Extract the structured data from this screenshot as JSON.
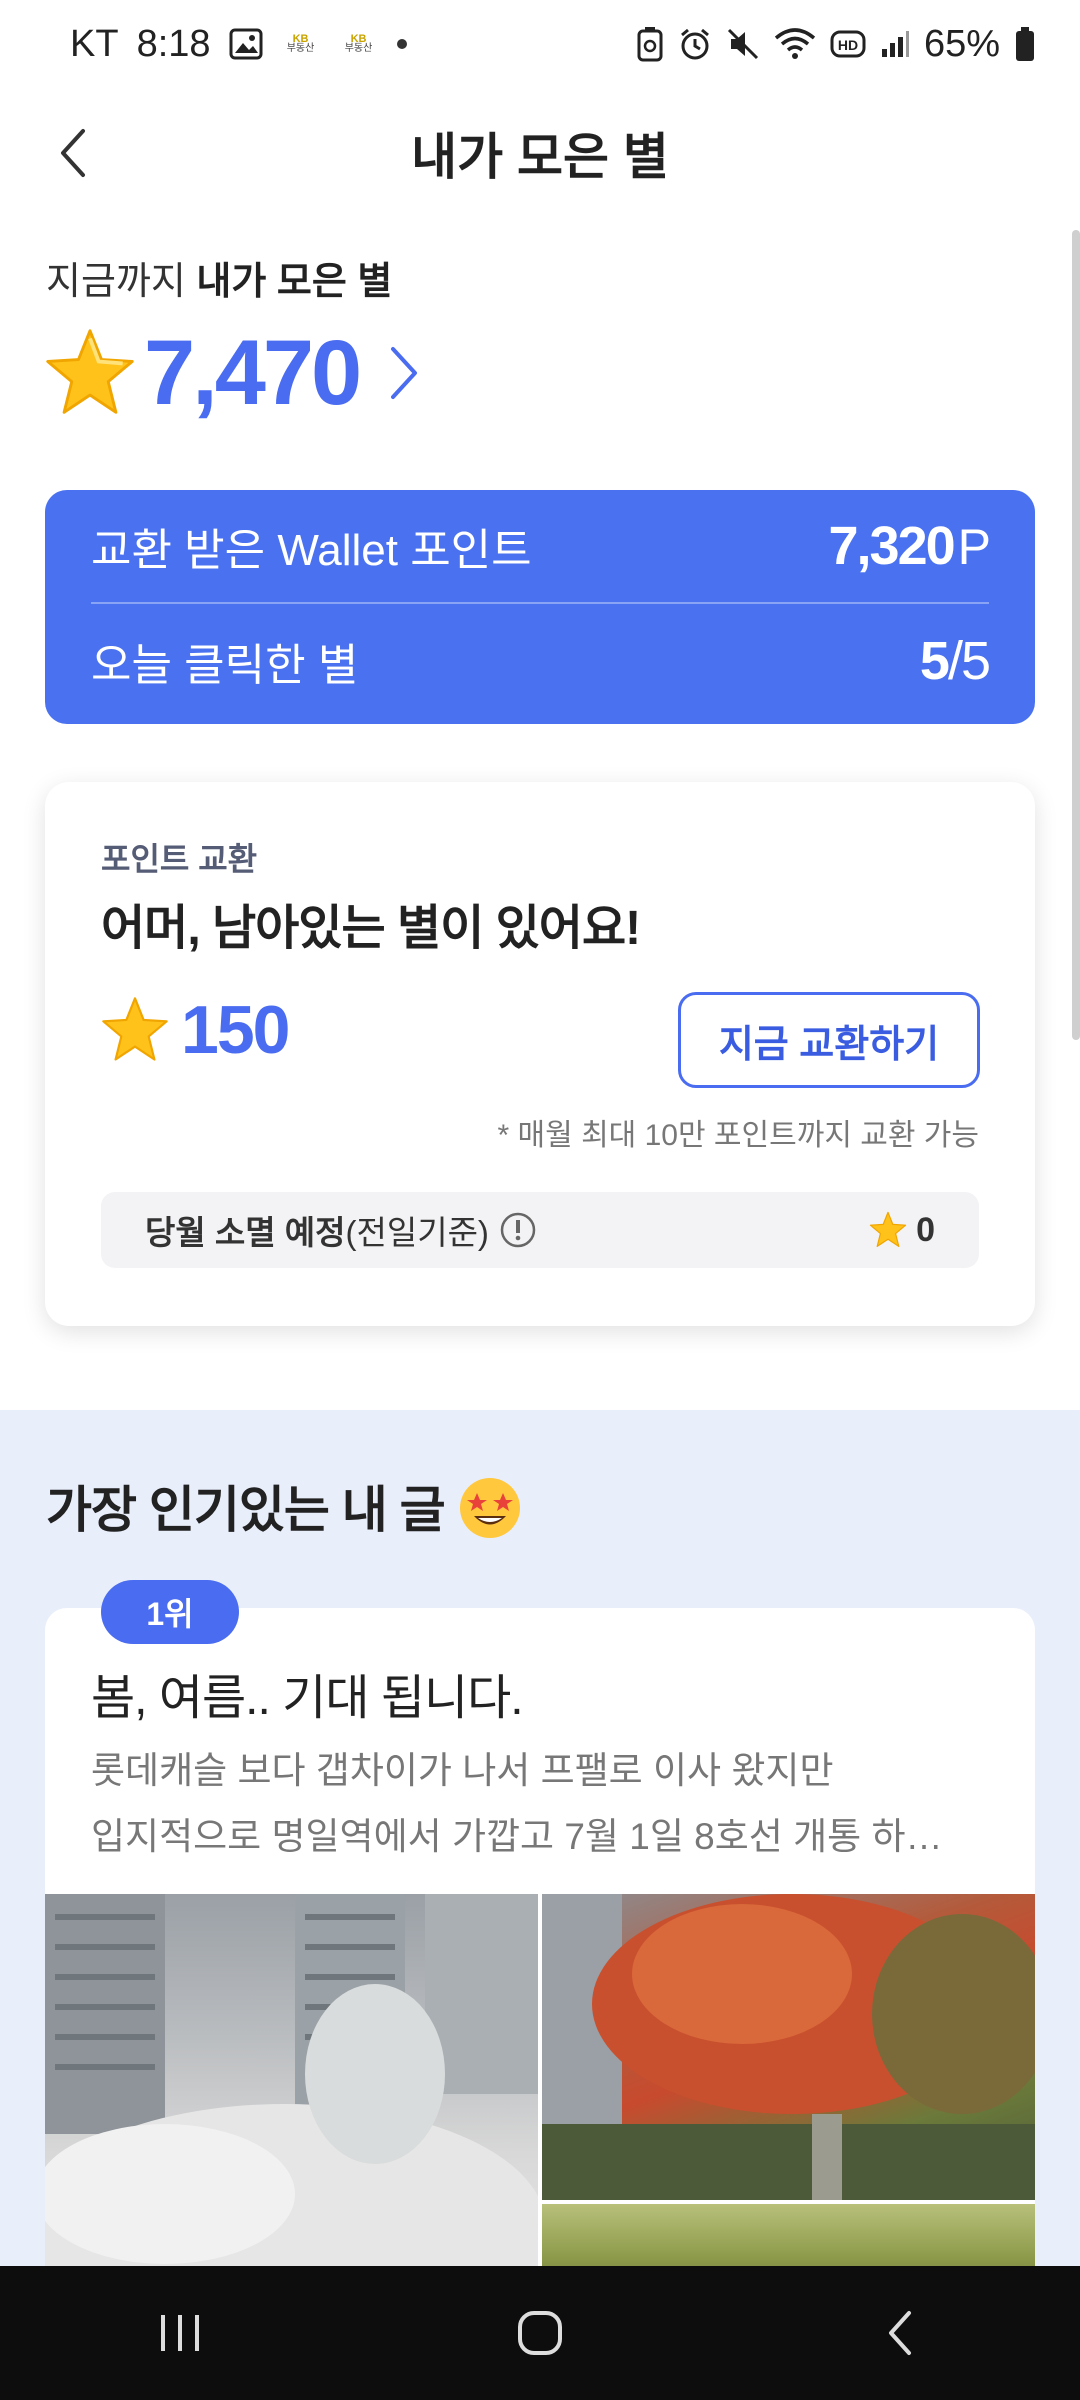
{
  "status_bar": {
    "carrier": "KT",
    "time": "8:18",
    "kb_label_top": "KB",
    "kb_label_bottom": "부동산",
    "battery": "65%"
  },
  "header": {
    "title": "내가 모은 별"
  },
  "summary": {
    "label_prefix": "지금까지",
    "label_bold": "내가 모은 별",
    "total_stars": "7,470"
  },
  "wallet_card": {
    "exchanged_label": "교환 받은 Wallet 포인트",
    "exchanged_value": "7,320",
    "exchanged_unit": "P",
    "today_label": "오늘 클릭한 별",
    "today_clicked": "5",
    "today_slash": "/",
    "today_max": "5"
  },
  "exchange_card": {
    "kicker": "포인트 교환",
    "title": "어머, 남아있는 별이 있어요!",
    "remaining_stars": "150",
    "button_label": "지금 교환하기",
    "note": "* 매월 최대 10만 포인트까지 교환 가능",
    "expire_label_bold": "당월 소멸 예정",
    "expire_label_suffix": "(전일기준)",
    "expire_value": "0"
  },
  "popular": {
    "title": "가장 인기있는 내 글",
    "post": {
      "rank": "1위",
      "title": "봄, 여름.. 기대 됩니다.",
      "excerpt_line1": "롯데캐슬 보다 갭차이가 나서 프팰로 이사 왔지만",
      "excerpt_line2": "입지적으로 명일역에서 가깝고 7월 1일 8호선 개통 하…"
    }
  },
  "colors": {
    "accent": "#4a6cf0",
    "card_blue": "#4a72f0",
    "star": "#ffc21a",
    "section_bg": "#e9eefb"
  },
  "icons": {
    "back": "chevron-left-icon",
    "total_more": "chevron-right-icon",
    "star": "star-icon",
    "info": "info-circle-icon",
    "emoji": "star-struck-emoji-icon"
  }
}
